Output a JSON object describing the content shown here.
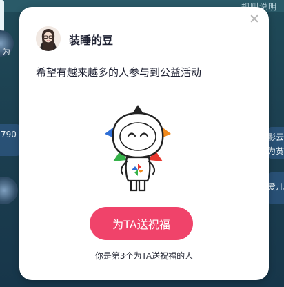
{
  "background": {
    "top_link": "规则说明",
    "fragments": [
      "为",
      "790",
      "影云",
      "为贫",
      "爱儿"
    ]
  },
  "modal": {
    "username": "装睡的豆",
    "message": "希望有越来越多的人参与到公益活动",
    "button_label": "为TA送祝福",
    "bless_count_text": "你是第3个为TA送祝福的人"
  },
  "colors": {
    "accent": "#f0436a",
    "text": "#1f2233",
    "backdrop": "#1c3f50"
  }
}
